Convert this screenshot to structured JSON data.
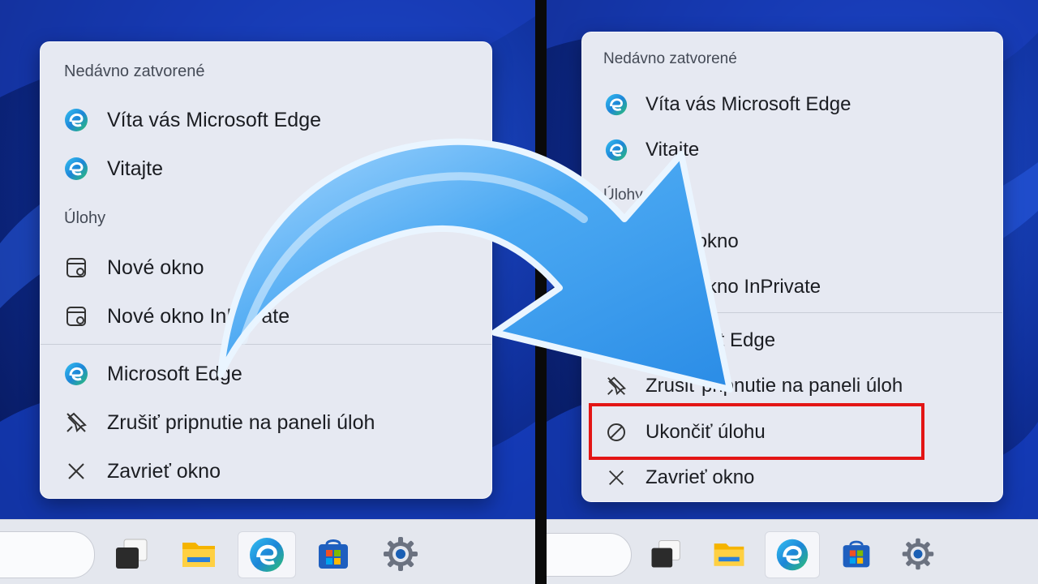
{
  "left_menu": {
    "section_recent": "Nedávno zatvorené",
    "recent_items": [
      {
        "label": "Víta vás Microsoft Edge",
        "icon": "edge-icon"
      },
      {
        "label": "Vitajte",
        "icon": "edge-icon"
      }
    ],
    "section_tasks": "Úlohy",
    "task_items": [
      {
        "label": "Nové okno",
        "icon": "browser-window-icon"
      },
      {
        "label": "Nové okno InPrivate",
        "icon": "browser-window-icon"
      }
    ],
    "app_items": [
      {
        "label": "Microsoft Edge",
        "icon": "edge-icon"
      },
      {
        "label": "Zrušiť pripnutie na paneli úloh",
        "icon": "unpin-icon"
      },
      {
        "label": "Zavrieť okno",
        "icon": "close-icon"
      }
    ]
  },
  "right_menu": {
    "section_recent": "Nedávno zatvorené",
    "recent_items": [
      {
        "label": "Víta vás Microsoft Edge",
        "icon": "edge-icon"
      },
      {
        "label": "Vitajte",
        "icon": "edge-icon"
      }
    ],
    "section_tasks": "Úlohy",
    "task_items": [
      {
        "label": "Nové okno",
        "icon": "browser-window-icon"
      },
      {
        "label": "Nové okno InPrivate",
        "icon": "browser-window-icon"
      }
    ],
    "app_items": [
      {
        "label": "Microsoft Edge",
        "icon": "edge-icon"
      },
      {
        "label": "Zrušiť pripnutie na paneli úloh",
        "icon": "unpin-icon"
      },
      {
        "label": "Ukončiť úlohu",
        "icon": "end-task-icon"
      },
      {
        "label": "Zavrieť okno",
        "icon": "close-icon"
      }
    ]
  },
  "taskbar_icons": [
    "task-view-icon",
    "file-explorer-icon",
    "edge-icon",
    "store-icon",
    "settings-icon"
  ],
  "colors": {
    "highlight": "#e31515",
    "arrow": "#3aa0f0",
    "accent": "#1a5fb4"
  }
}
